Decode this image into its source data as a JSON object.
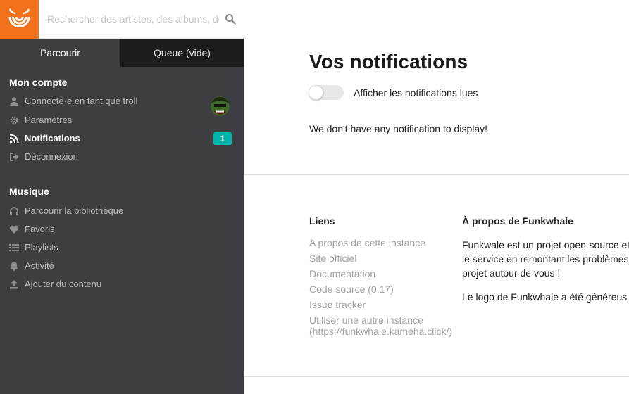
{
  "search": {
    "placeholder": "Rechercher des artistes, des albums, des morceaux…"
  },
  "tabs": {
    "browse": "Parcourir",
    "queue": "Queue (vide)"
  },
  "account": {
    "title": "Mon compte",
    "items": [
      {
        "label": "Connecté·e en tant que troll",
        "icon": "user-icon"
      },
      {
        "label": "Paramètres",
        "icon": "gear-icon"
      },
      {
        "label": "Notifications",
        "icon": "feed-icon",
        "badge": "1"
      },
      {
        "label": "Déconnexion",
        "icon": "sign-out-icon"
      }
    ]
  },
  "music": {
    "title": "Musique",
    "items": [
      {
        "label": "Parcourir la bibliothèque",
        "icon": "headphones-icon"
      },
      {
        "label": "Favoris",
        "icon": "heart-icon"
      },
      {
        "label": "Playlists",
        "icon": "list-icon"
      },
      {
        "label": "Activité",
        "icon": "bell-icon"
      },
      {
        "label": "Ajouter du contenu",
        "icon": "upload-icon"
      }
    ]
  },
  "main": {
    "title": "Vos notifications",
    "toggle_label": "Afficher les notifications lues",
    "empty_message": "We don't have any notification to display!"
  },
  "footer": {
    "links_title": "Liens",
    "links": [
      "A propos de cette instance",
      "Site officiel",
      "Documentation",
      "Code source (0.17)",
      "Issue tracker",
      "Utiliser une autre instance",
      "(https://funkwhale.kameha.click/)"
    ],
    "about_title": "À propos de Funkwhale",
    "about_lines": [
      "Funkwale est un projet open-source et",
      "le service en remontant les problèmes",
      "projet autour de vous !"
    ],
    "about_logo": "Le logo de Funkwhale a été généreus"
  },
  "colors": {
    "brand_orange": "#f2711c",
    "sidebar_bg": "#3c3e42",
    "tab_dark": "#1b1c1d",
    "badge_teal": "#00b5ad"
  }
}
